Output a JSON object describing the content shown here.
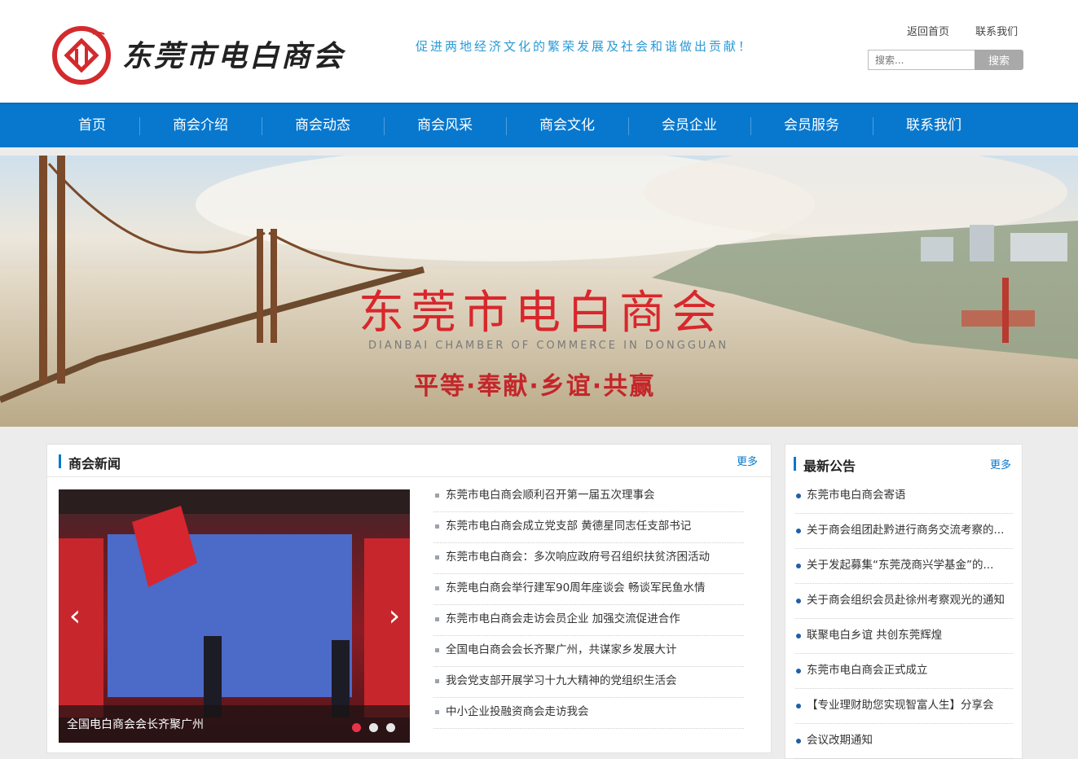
{
  "header": {
    "logo_text": "东莞市电白商会",
    "slogan": "促进两地经济文化的繁荣发展及社会和谐做出贡献！",
    "links": [
      "返回首页",
      "联系我们"
    ],
    "search_placeholder": "搜索...",
    "search_button": "搜索"
  },
  "nav": {
    "items": [
      "首页",
      "商会介绍",
      "商会动态",
      "商会风采",
      "商会文化",
      "会员企业",
      "会员服务",
      "联系我们"
    ]
  },
  "banner": {
    "title": "东莞市电白商会",
    "subtitle": "DIANBAI CHAMBER OF COMMERCE IN DONGGUAN",
    "motto": "平等·奉献·乡谊·共赢"
  },
  "news": {
    "title": "商会新闻",
    "more": "更多",
    "slider_caption": "全国电白商会会长齐聚广州",
    "items": [
      "东莞市电白商会顺利召开第一届五次理事会",
      "东莞市电白商会成立党支部 黄德星同志任支部书记",
      "东莞市电白商会：多次响应政府号召组织扶贫济困活动",
      "东莞电白商会举行建军90周年座谈会 畅谈军民鱼水情",
      "东莞市电白商会走访会员企业 加强交流促进合作",
      "全国电白商会会长齐聚广州，共谋家乡发展大计",
      "我会党支部开展学习十九大精神的党组织生活会",
      "中小企业投融资商会走访我会"
    ]
  },
  "notice": {
    "title": "最新公告",
    "more": "更多",
    "items": [
      "东莞市电白商会寄语",
      "关于商会组团赴黔进行商务交流考察的...",
      "关于发起募集“东莞茂商兴学基金”的...",
      "关于商会组织会员赴徐州考察观光的通知",
      "联聚电白乡谊 共创东莞辉煌",
      "东莞市电白商会正式成立",
      "【专业理财助您实现智富人生】分享会",
      "会议改期通知"
    ]
  },
  "colors": {
    "nav_bg": "#0878ce",
    "slogan": "#2a9ad6",
    "banner_title": "#d8272c",
    "active_dot": "#e8334a"
  },
  "icons": [
    "logo-emblem",
    "chevron-left-icon",
    "chevron-right-icon"
  ]
}
